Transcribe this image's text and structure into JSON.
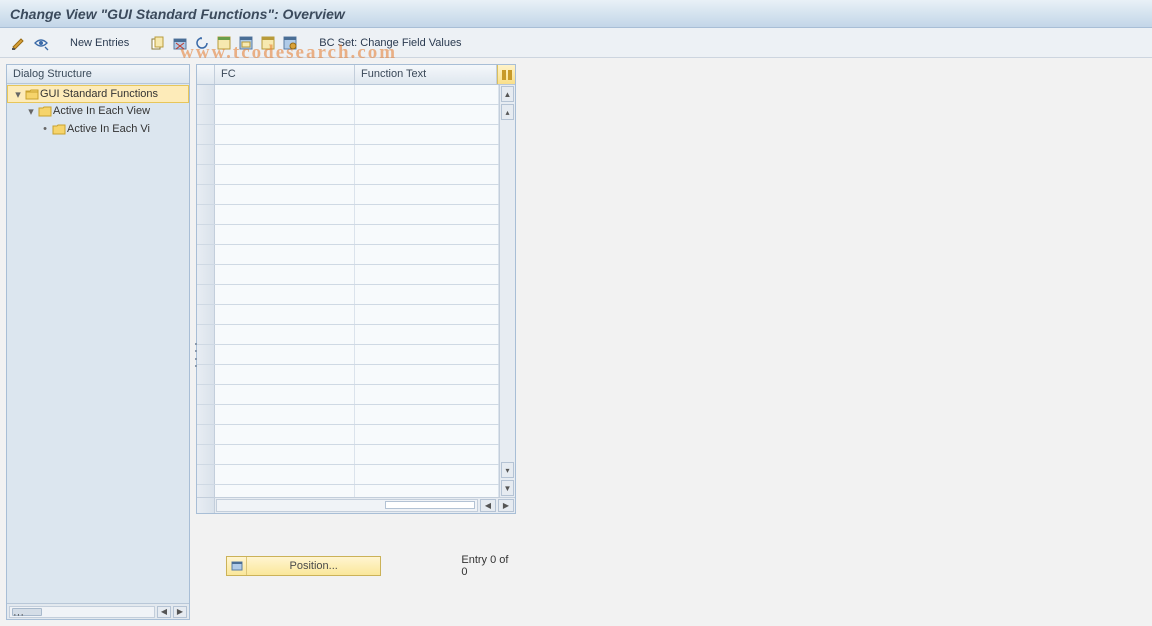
{
  "title": "Change View \"GUI Standard Functions\": Overview",
  "toolbar": {
    "new_entries": "New Entries",
    "bc_set": "BC Set: Change Field Values"
  },
  "sidebar": {
    "header": "Dialog Structure",
    "items": [
      {
        "label": "GUI Standard Functions",
        "level": 0,
        "selected": true,
        "open": true,
        "expander": "▾"
      },
      {
        "label": "Active In Each View",
        "level": 1,
        "selected": false,
        "open": false,
        "expander": "▾"
      },
      {
        "label": "Active In Each Vi",
        "level": 2,
        "selected": false,
        "open": false,
        "expander": "•"
      }
    ]
  },
  "grid": {
    "columns": {
      "fc": "FC",
      "ft": "Function Text"
    },
    "row_count": 21
  },
  "bottom": {
    "position_label": "Position...",
    "entry_status": "Entry 0 of 0"
  },
  "watermark": "www.tcodesearch.com"
}
